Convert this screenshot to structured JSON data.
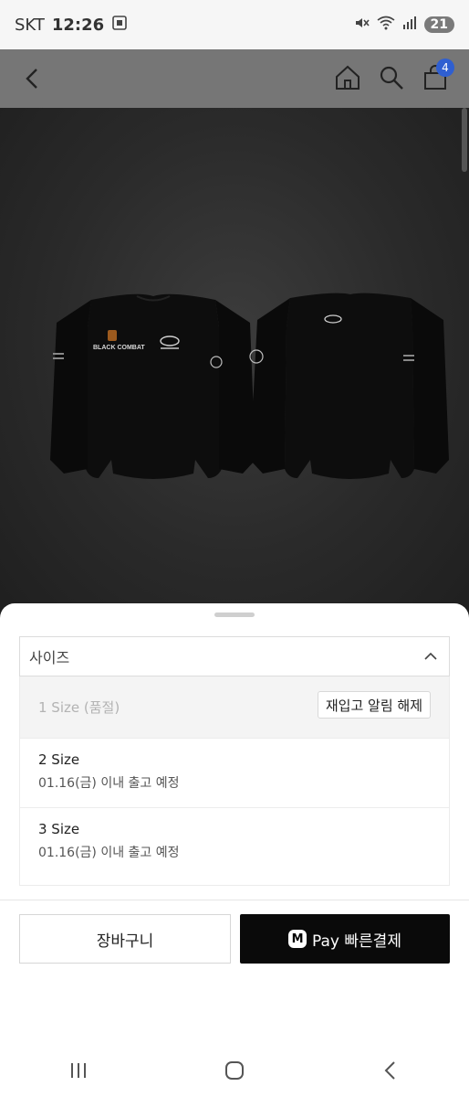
{
  "status_bar": {
    "carrier": "SKT",
    "time": "12:26",
    "battery": "21"
  },
  "app_bar": {
    "cart_count": "4"
  },
  "product": {
    "front_logo_text": "BLACK COMBAT"
  },
  "sheet": {
    "select_label": "사이즈",
    "options": [
      {
        "name": "1 Size (품절)",
        "action": "재입고 알림 해제"
      },
      {
        "name": "2 Size",
        "shipping": "01.16(금) 이내 출고 예정"
      },
      {
        "name": "3 Size",
        "shipping": "01.16(금) 이내 출고 예정"
      }
    ],
    "cart_button": "장바구니",
    "pay_button": "Pay 빠른결제",
    "pay_logo": "M"
  },
  "colors": {
    "pay_button_bg": "#0a0a0a",
    "badge": "#2f5fd1",
    "overlay": "#767676"
  }
}
